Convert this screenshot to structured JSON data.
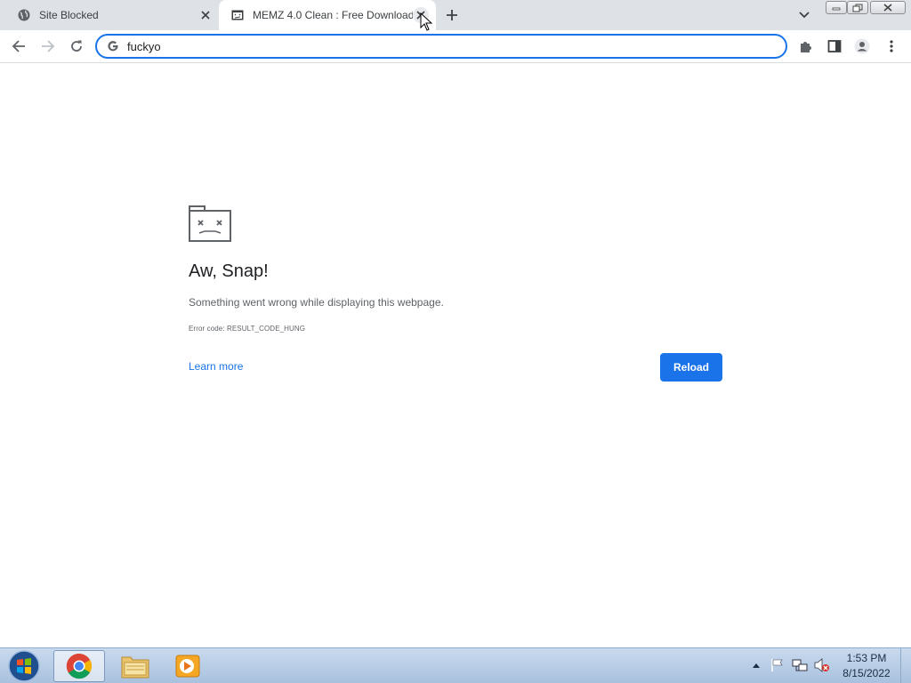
{
  "tabs": [
    {
      "title": "Site Blocked",
      "active": false
    },
    {
      "title": "MEMZ 4.0 Clean : Free Download",
      "active": true
    }
  ],
  "omnibox": {
    "value": "fuckyo",
    "placeholder": ""
  },
  "error": {
    "title": "Aw, Snap!",
    "message": "Something went wrong while displaying this webpage.",
    "code": "Error code: RESULT_CODE_HUNG",
    "learn_more": "Learn more",
    "reload": "Reload"
  },
  "taskbar": {
    "apps": [
      "chrome-icon",
      "explorer-folder-icon",
      "media-player-icon"
    ],
    "tray_icons": [
      "tray-expand-icon",
      "action-center-flag-icon",
      "network-icon",
      "volume-muted-icon"
    ],
    "time": "1:53 PM",
    "date": "8/15/2022"
  },
  "colors": {
    "accent": "#1a73e8",
    "tabstrip": "#dee1e6",
    "taskbar": "#b9cde6"
  }
}
